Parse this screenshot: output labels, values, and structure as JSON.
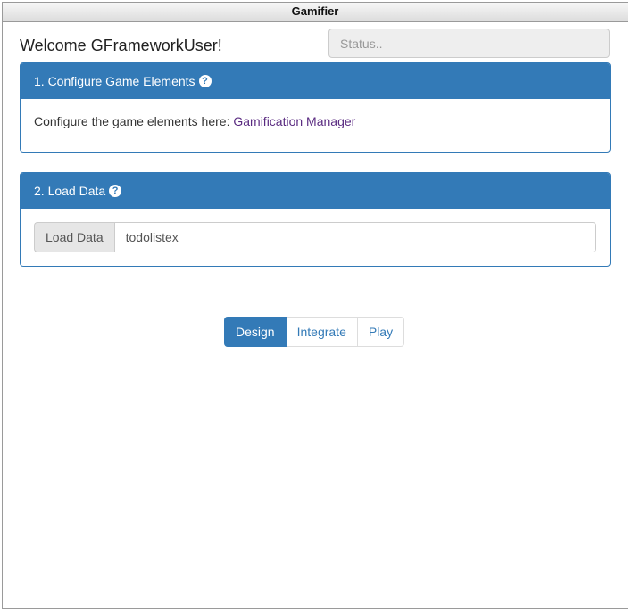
{
  "window": {
    "title": "Gamifier"
  },
  "header": {
    "welcome": "Welcome GFrameworkUser!",
    "status_placeholder": "Status..",
    "status_value": ""
  },
  "panels": [
    {
      "title": "1. Configure Game Elements",
      "help_icon": "?",
      "body_text": "Configure the game elements here: ",
      "link_text": "Gamification Manager"
    },
    {
      "title": "2. Load Data",
      "help_icon": "?",
      "addon_label": "Load Data",
      "input_value": "todolistex"
    }
  ],
  "tabs": [
    {
      "label": "Design",
      "active": true
    },
    {
      "label": "Integrate",
      "active": false
    },
    {
      "label": "Play",
      "active": false
    }
  ],
  "colors": {
    "primary": "#337ab7",
    "link": "#5a2b81"
  }
}
